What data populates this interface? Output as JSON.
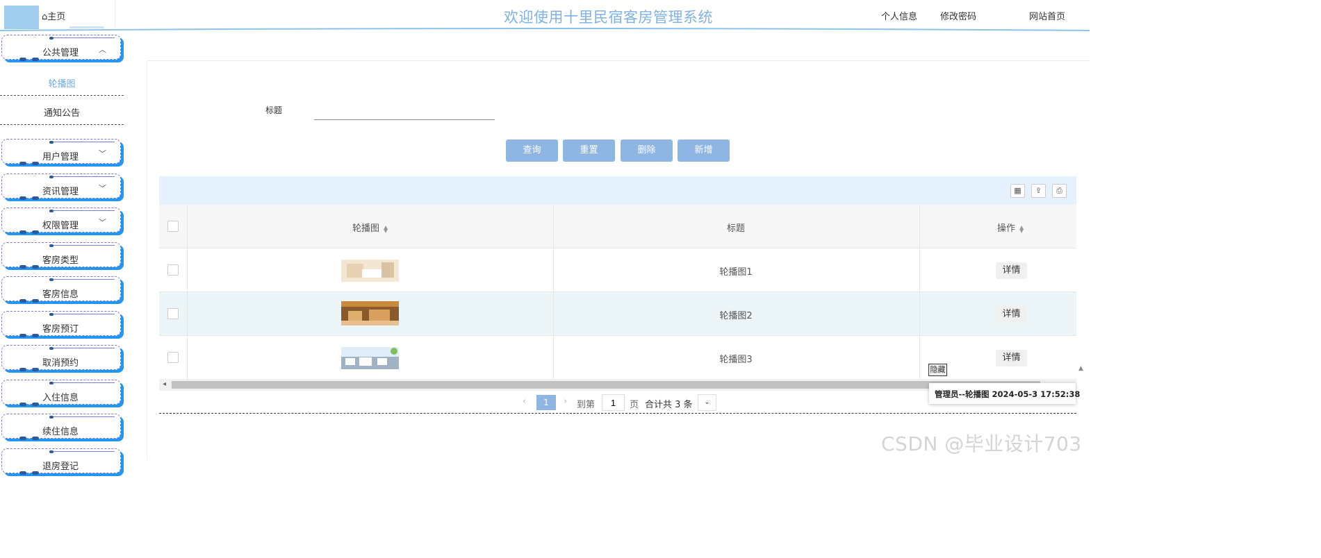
{
  "header": {
    "home_label": "主页",
    "title": "欢迎使用十里民宿客房管理系统",
    "nav": [
      "个人信息",
      "修改密码",
      "网站首页"
    ]
  },
  "sidebar": {
    "public": {
      "label": "公共管理",
      "sub_items": [
        "轮播图",
        "通知公告"
      ]
    },
    "menus": [
      "用户管理",
      "资讯管理",
      "权限管理",
      "客房类型",
      "客房信息",
      "客房预订",
      "取消预约",
      "入住信息",
      "续住信息",
      "退房登记"
    ]
  },
  "search": {
    "label": "标题",
    "value": ""
  },
  "actions": [
    "查询",
    "重置",
    "删除",
    "新增"
  ],
  "table": {
    "columns": [
      "轮播图",
      "标题",
      "操作"
    ],
    "rows": [
      {
        "title": "轮播图1",
        "action": "详情"
      },
      {
        "title": "轮播图2",
        "action": "详情"
      },
      {
        "title": "轮播图3",
        "action": "详情"
      }
    ]
  },
  "pagination": {
    "current_page": "1",
    "goto_prefix": "到第",
    "goto_value": "1",
    "page_suffix": "页",
    "total": "合计共 3 条"
  },
  "hide_button": "隐藏",
  "tooltip": "管理员--轮播图 2024-05-3 17:52:38",
  "watermark": "CSDN @毕业设计703",
  "colors": {
    "accent": "#8fb5e2",
    "title": "#7fb2e5",
    "menu_shadow": "#2196f3",
    "toolbar_bg": "#e6f1fe"
  }
}
